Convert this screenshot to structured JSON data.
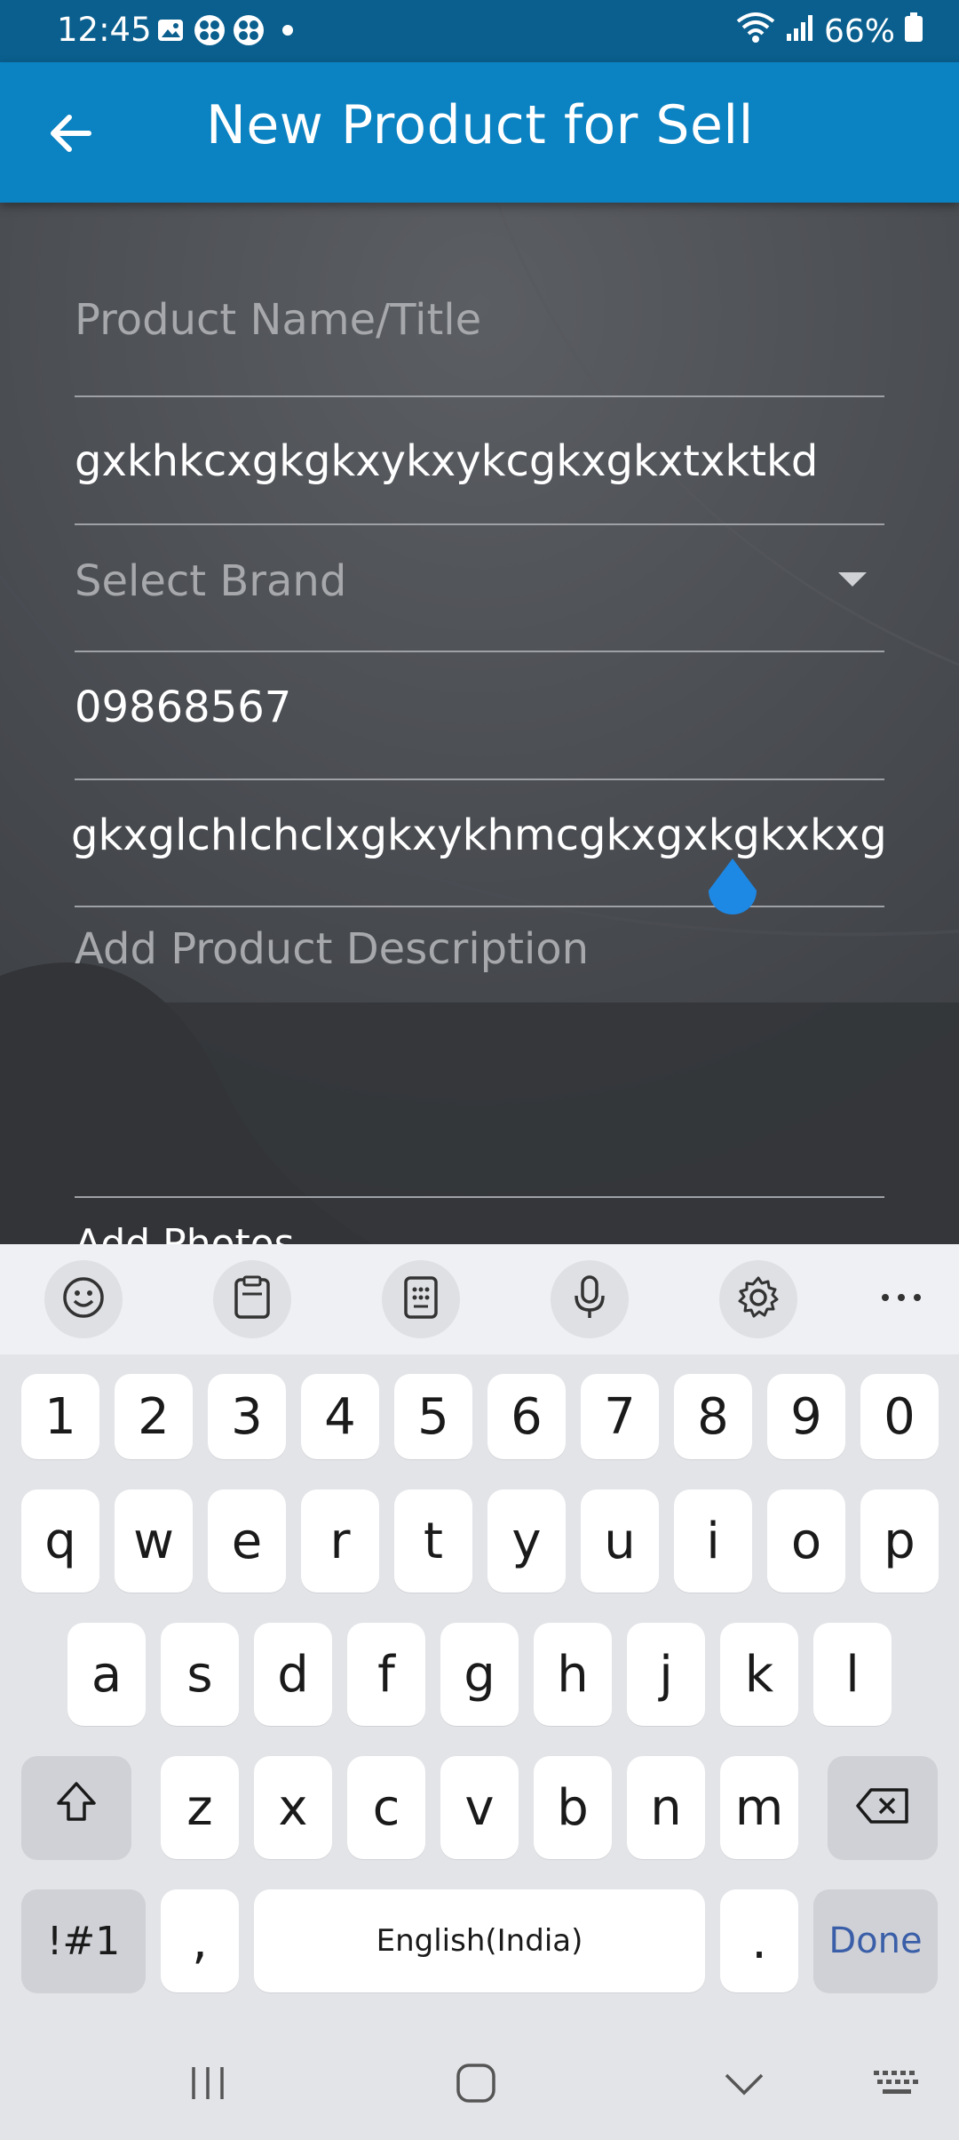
{
  "status_bar": {
    "time": "12:45",
    "battery": "66%"
  },
  "app_bar": {
    "title": "New Product for Sell",
    "back_icon": "arrow-left-icon"
  },
  "form": {
    "product_name_placeholder": "Product Name/Title",
    "field2_value": "gxkhkcxgkgkxykxykcgkxgkxtxktkd",
    "brand_placeholder": "Select Brand",
    "field4_value": "09868567",
    "field5_value": "gkxglchlchclxgkxykhmcgkxgxkgkxkxg",
    "description_placeholder": "Add Product Description",
    "photos_label": "Add Photos"
  },
  "keyboard": {
    "toolbar": [
      "emoji-icon",
      "clipboard-icon",
      "keypad-icon",
      "mic-icon",
      "settings-icon",
      "more-icon"
    ],
    "row_numbers": [
      "1",
      "2",
      "3",
      "4",
      "5",
      "6",
      "7",
      "8",
      "9",
      "0"
    ],
    "row_top": [
      "q",
      "w",
      "e",
      "r",
      "t",
      "y",
      "u",
      "i",
      "o",
      "p"
    ],
    "row_middle": [
      "a",
      "s",
      "d",
      "f",
      "g",
      "h",
      "j",
      "k",
      "l"
    ],
    "row_bottom": [
      "z",
      "x",
      "c",
      "v",
      "b",
      "n",
      "m"
    ],
    "symbols_label": "!#1",
    "comma_label": ",",
    "space_label": "English(India)",
    "period_label": ".",
    "done_label": "Done"
  },
  "colors": {
    "status_bar": "#0a5f8e",
    "app_bar": "#0b82c1",
    "cursor_handle": "#1e88e5",
    "done_text": "#3a5ea8"
  }
}
